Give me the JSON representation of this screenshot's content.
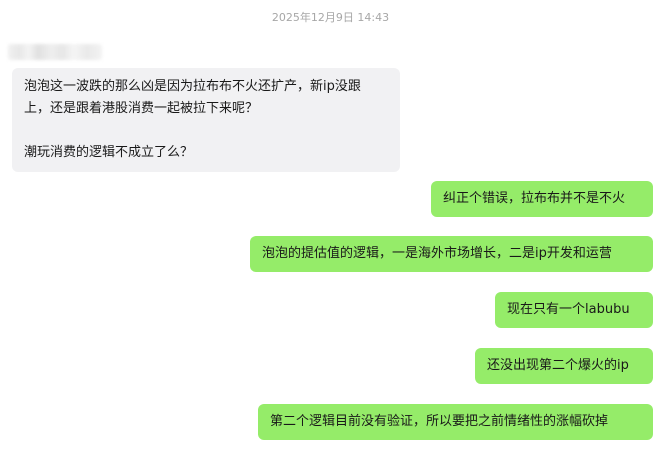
{
  "chat": {
    "timestamp": "2025年12月9日 14:43",
    "incoming": {
      "lines": [
        "泡泡这一波跌的那么凶是因为拉布布不火还扩产，新ip没跟",
        "上，还是跟着港股消费一起被拉下来呢？",
        "潮玩消费的逻辑不成立了么？"
      ]
    },
    "outgoing": [
      "纠正个错误，拉布布并不是不火",
      "泡泡的提估值的逻辑，一是海外市场增长，二是ip开发和运营",
      "现在只有一个labubu",
      "还没出现第二个爆火的ip",
      "第二个逻辑目前没有验证，所以要把之前情绪性的涨幅砍掉"
    ],
    "colors": {
      "incoming_bubble": "#f1f1f3",
      "outgoing_bubble": "#95ec69",
      "timestamp_text": "#a7a7a7"
    }
  }
}
